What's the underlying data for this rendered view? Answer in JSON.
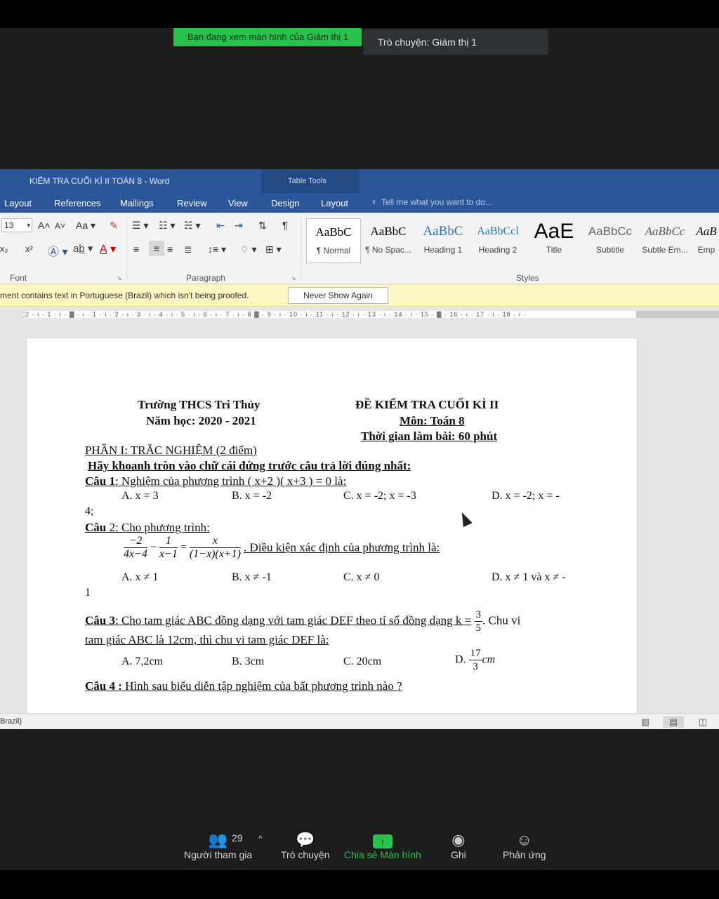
{
  "zoom": {
    "share_banner": "Bạn đang xem màn hình của Giám thị 1",
    "chat_banner": "Trò chuyện: Giám thị 1",
    "toolbar": {
      "participants_label": "Người tham gia",
      "participants_count": "29",
      "chat_label": "Trò chuyện",
      "share_label": "Chia sẻ Màn hình",
      "record_label": "Ghi",
      "reactions_label": "Phản ứng"
    }
  },
  "word": {
    "title": "KIỂM TRA CUỐI KÌ II TOÁN 8 - Word",
    "table_tools": "Table Tools",
    "tabs": [
      "Layout",
      "References",
      "Mailings",
      "Review",
      "View",
      "Design",
      "Layout"
    ],
    "tell_me": "Tell me what you want to do...",
    "font_size": "13",
    "groups": {
      "font": "Font",
      "paragraph": "Paragraph",
      "styles": "Styles"
    },
    "styles": [
      {
        "sample": "AaBbC",
        "name": "¶ Normal"
      },
      {
        "sample": "AaBbC",
        "name": "¶ No Spac..."
      },
      {
        "sample": "AaBbC",
        "name": "Heading 1"
      },
      {
        "sample": "AaBbCcl",
        "name": "Heading 2"
      },
      {
        "sample": "AaE",
        "name": "Title"
      },
      {
        "sample": "AaBbCc",
        "name": "Subtitle"
      },
      {
        "sample": "AaBbCc",
        "name": "Subtle Em..."
      },
      {
        "sample": "AaB",
        "name": "Emp"
      }
    ],
    "proof_message": "ment contains text in Portuguese (Brazil) which isn't being proofed.",
    "proof_button": "Never Show Again",
    "ruler": "2 · ı · 1 · ı · ▓ · ı · 1 · ı · 2 · ı · 3 · ı · 4 · ı · 5 · ı · 6 · ı · 7 · ı · 8 ▓ · 9 · ı · 10 · ı · 11 · ı · 12 · ı · 13 · ı · 14 · ı · 15 · ▓ · 16 · ı · 17 · ı · 18 · ı ·",
    "status_language": "Brazil)"
  },
  "doc": {
    "school": "Trường THCS Tri Thủy",
    "year": "Năm học: 2020 - 2021",
    "exam_title": "ĐỀ KIỂM TRA CUỐI KÌ II",
    "subject": "Môn: Toán 8",
    "time": "Thời gian làm bài: 60 phút",
    "part1": "PHẦN I: TRẮC NGHIỆM (2 điểm)",
    "instruction": "Hãy khoanh tròn vào chữ cái  đứng trước câu trả lời đúng nhất:",
    "q1": {
      "label": "Câu 1",
      "text": ": Nghiệm của phương trình  ( x+2 )( x+3 ) = 0 là:",
      "a": "A.  x = 3",
      "b": "B.  x = -2",
      "c": "C.  x = -2; x = -3",
      "d": "D.  x = -2; x = -",
      "wrap": "4;"
    },
    "q2": {
      "label": "Câu ",
      "text": "2: Cho phương trình:",
      "f1_num": "−2",
      "f1_den": "4x−4",
      "minus": "−",
      "f2_num": "1",
      "f2_den": "x−1",
      "eq": "=",
      "f3_num": "x",
      "f3_den": "(1−x)(x+1)",
      "tail": ". Điều kiện xác định của phương trình là:",
      "a": "A. x ≠ 1",
      "b": "B. x ≠ -1",
      "c": "C. x ≠ 0",
      "d": "D. x ≠ 1 và x ≠ -",
      "wrap": "1"
    },
    "q3": {
      "label": "Câu 3",
      "text": ": Cho tam giác ABC đồng dạng với tam giác DEF theo tỉ số đồng dạng k =",
      "k_num": "3",
      "k_den": "5",
      "tail": ". Chu vi",
      "line2": "tam giác ABC là 12cm, thì chu vi tam giác DEF là:",
      "a": "A. 7,2cm",
      "b": "B. 3cm",
      "c": "C. 20cm",
      "d": "D.",
      "d_num": "17",
      "d_den": "3",
      "d_unit": "cm"
    },
    "q4": {
      "label": "Câu 4 :",
      "text": " Hình sau biểu diễn tập nghiệm của bất phương trình nào ?"
    }
  }
}
